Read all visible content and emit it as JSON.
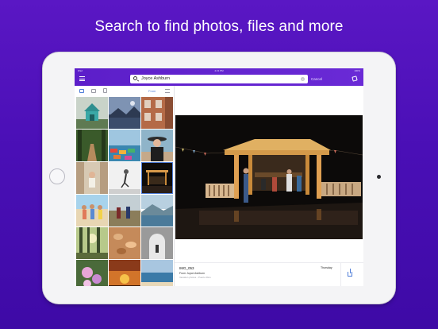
{
  "headline": "Search to find photos, files and more",
  "status_bar": {
    "carrier": "iPad",
    "time": "4:21 PM",
    "battery": "100%"
  },
  "nav": {
    "search_value": "Joyce Ashburn",
    "cancel_label": "Cancel"
  },
  "filters": {
    "from_label": "From"
  },
  "icons": {
    "menu": "menu-icon",
    "search": "search-icon",
    "clear": "clear-icon",
    "compose": "compose-icon",
    "mail": "mail-icon",
    "photo": "photo-icon",
    "file": "file-icon",
    "sort": "sort-icon",
    "share": "share-icon"
  },
  "colors": {
    "accent": "#5c1ec9",
    "link": "#4f7dd8",
    "background": "#4a0fb6"
  },
  "detail": {
    "file_name": "IMG_053",
    "from": "From Joyce Ashburn",
    "subject": "Vacation photos - Puerto Rico",
    "date": "Thursday"
  },
  "thumbnails": [
    {
      "desc": "treehouse"
    },
    {
      "desc": "lake-dusk"
    },
    {
      "desc": "brick-building"
    },
    {
      "desc": "forest-path"
    },
    {
      "desc": "boats"
    },
    {
      "desc": "woman-hat"
    },
    {
      "desc": "street-girl"
    },
    {
      "desc": "jumper"
    },
    {
      "desc": "night-pavilion"
    },
    {
      "desc": "group-beach"
    },
    {
      "desc": "people-field"
    },
    {
      "desc": "sea-hills"
    },
    {
      "desc": "trees-sun"
    },
    {
      "desc": "autumn-leaves"
    },
    {
      "desc": "arch-window"
    },
    {
      "desc": "flowers"
    },
    {
      "desc": "sunset-sky"
    },
    {
      "desc": "beach-sea"
    }
  ]
}
